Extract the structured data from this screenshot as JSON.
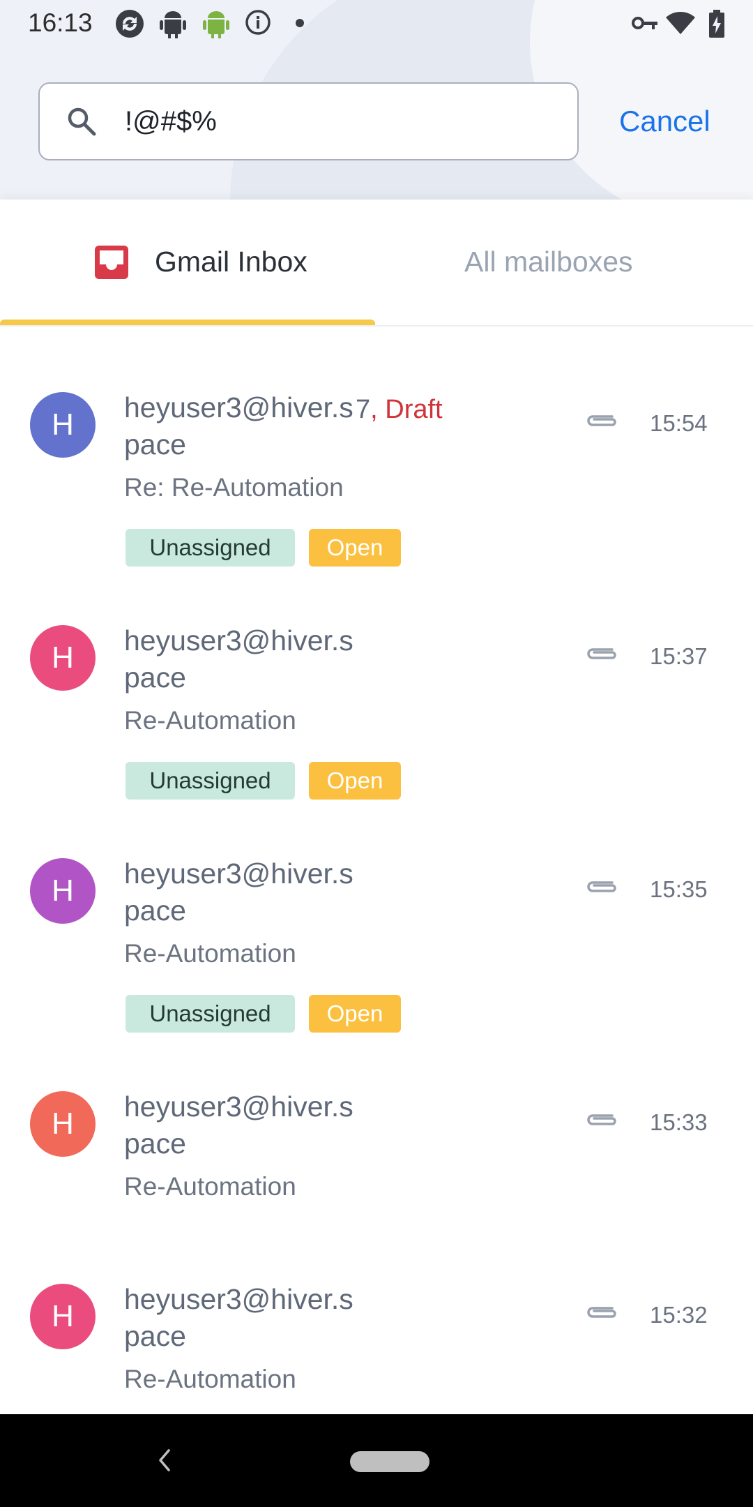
{
  "status_bar": {
    "time": "16:13",
    "icons": [
      "sync-icon",
      "android-gray-icon",
      "android-green-icon",
      "info-icon",
      "dot-icon",
      "vpn-key-icon",
      "wifi-icon",
      "battery-charging-icon"
    ]
  },
  "search": {
    "value": "!@#$%",
    "cancel_label": "Cancel"
  },
  "tabs": [
    {
      "label": "Gmail Inbox",
      "icon": "inbox-icon",
      "active": true
    },
    {
      "label": "All mailboxes",
      "active": false
    }
  ],
  "emails": [
    {
      "avatar": "H",
      "avatar_color": "#6272cd",
      "sender": "heyuser3@hiver.space",
      "count": "7",
      "draft": "Draft",
      "subject": "Re: Re-Automation",
      "time": "15:54",
      "tags": [
        "Unassigned",
        "Open"
      ]
    },
    {
      "avatar": "H",
      "avatar_color": "#ea4d7d",
      "sender": "heyuser3@hiver.space",
      "subject": "Re-Automation",
      "time": "15:37",
      "tags": [
        "Unassigned",
        "Open"
      ]
    },
    {
      "avatar": "H",
      "avatar_color": "#b154c6",
      "sender": "heyuser3@hiver.space",
      "subject": "Re-Automation",
      "time": "15:35",
      "tags": [
        "Unassigned",
        "Open"
      ]
    },
    {
      "avatar": "H",
      "avatar_color": "#f16958",
      "sender": "heyuser3@hiver.space",
      "subject": "Re-Automation",
      "time": "15:33",
      "tags": []
    },
    {
      "avatar": "H",
      "avatar_color": "#ea4d7d",
      "sender": "heyuser3@hiver.space",
      "subject": "Re-Automation",
      "time": "15:32",
      "tags": []
    }
  ],
  "colors": {
    "accent": "#1a73e8",
    "tab_indicator": "#f7c948",
    "tag_unassigned": "#c9e9de",
    "tag_open": "#fbc03f",
    "draft": "#d0343a"
  }
}
